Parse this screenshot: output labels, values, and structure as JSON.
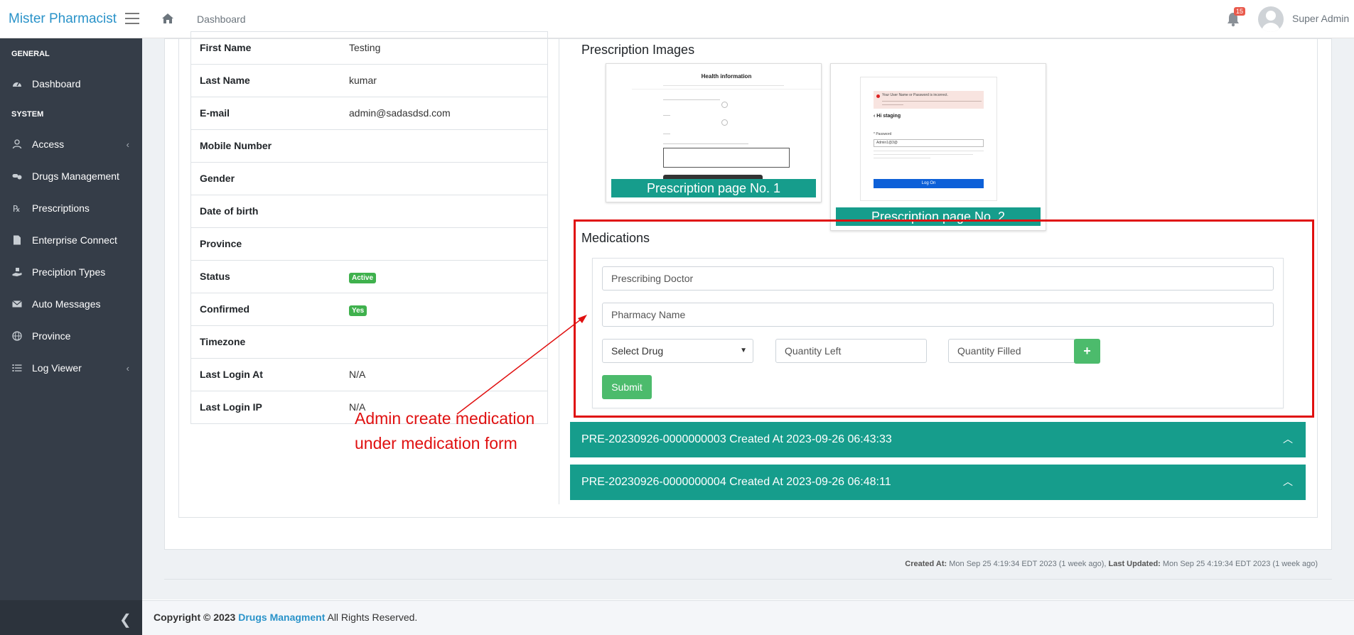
{
  "app": {
    "brand": "Mister Pharmacist"
  },
  "header": {
    "breadcrumb": "Dashboard",
    "notification_count": "15",
    "user_name": "Super Admin"
  },
  "sidebar": {
    "heading_general": "GENERAL",
    "heading_system": "SYSTEM",
    "items": [
      {
        "label": "Dashboard",
        "icon": "dashboard-icon"
      },
      {
        "label": "Access",
        "icon": "user-icon",
        "chevron": "‹"
      },
      {
        "label": "Drugs Management",
        "icon": "pills-icon"
      },
      {
        "label": "Prescriptions",
        "icon": "prescription-icon"
      },
      {
        "label": "Enterprise Connect",
        "icon": "file-icon"
      },
      {
        "label": "Preciption Types",
        "icon": "hand-holding-icon"
      },
      {
        "label": "Auto Messages",
        "icon": "envelope-icon"
      },
      {
        "label": "Province",
        "icon": "globe-icon"
      },
      {
        "label": "Log Viewer",
        "icon": "list-icon",
        "chevron": "‹"
      }
    ]
  },
  "profile": {
    "rows": [
      {
        "label": "First Name",
        "value": "Testing"
      },
      {
        "label": "Last Name",
        "value": "kumar"
      },
      {
        "label": "E-mail",
        "value": "admin@sadasdsd.com"
      },
      {
        "label": "Mobile Number",
        "value": ""
      },
      {
        "label": "Gender",
        "value": ""
      },
      {
        "label": "Date of birth",
        "value": ""
      },
      {
        "label": "Province",
        "value": ""
      },
      {
        "label": "Status",
        "badge": "Active"
      },
      {
        "label": "Confirmed",
        "badge": "Yes"
      },
      {
        "label": "Timezone",
        "value": ""
      },
      {
        "label": "Last Login At",
        "value": "N/A"
      },
      {
        "label": "Last Login IP",
        "value": "N/A"
      }
    ]
  },
  "prescription_images": {
    "title": "Prescription Images",
    "captions": [
      "Prescription page No. 1",
      "Prescription page No. 2"
    ],
    "thumb1": {
      "heading": "Health information"
    },
    "thumb2": {
      "error_text": "Your User Name or Password is incorrect.",
      "login_title": "‹ Hi staging",
      "password_label": "* Password",
      "password_value": "Admin1@3@",
      "button": "Log On"
    }
  },
  "medications": {
    "title": "Medications",
    "prescribing_doctor_placeholder": "Prescribing Doctor",
    "pharmacy_name_placeholder": "Pharmacy Name",
    "select_drug": "Select Drug",
    "quantity_left_placeholder": "Quantity Left",
    "quantity_filled_placeholder": "Quantity Filled",
    "add_label": "+",
    "submit_label": "Submit"
  },
  "prescriptions": [
    {
      "label": "PRE-20230926-0000000003 Created At 2023-09-26 06:43:33"
    },
    {
      "label": "PRE-20230926-0000000004 Created At 2023-09-26 06:48:11"
    }
  ],
  "annotation": {
    "line1": "Admin create medication",
    "line2": "under medication form",
    "color": "#e01010"
  },
  "meta": {
    "created_label": "Created At:",
    "created_value": "Mon Sep 25 4:19:34 EDT 2023 (1 week ago),",
    "updated_label": "Last Updated:",
    "updated_value": "Mon Sep 25 4:19:34 EDT 2023 (1 week ago)"
  },
  "footer": {
    "copyright": "Copyright © 2023",
    "link": "Drugs Managment",
    "suffix": "All Rights Reserved."
  },
  "colors": {
    "brand": "#2a93c9",
    "sidebar": "#353d48",
    "teal": "#169d8c",
    "success": "#4cbb6c"
  }
}
